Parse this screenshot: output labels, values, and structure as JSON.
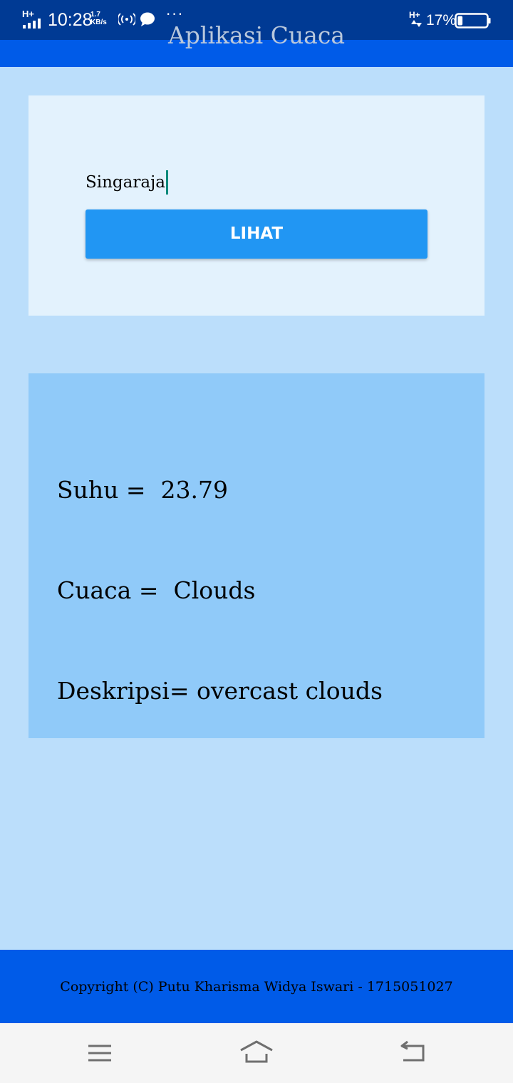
{
  "status_bar": {
    "network_type": "H+",
    "time": "10:28",
    "speed_value": "1.7",
    "speed_unit": "KB/s",
    "more_indicator": "···",
    "network_type_right": "H+",
    "battery_percent": "17%",
    "battery_level": 0.17,
    "icons": [
      "signal-icon",
      "hotspot-icon",
      "chat-bubble-icon",
      "network-arrows-icon",
      "battery-icon"
    ]
  },
  "app_bar": {
    "title": "Aplikasi Cuaca"
  },
  "search": {
    "city_value": "Singaraja",
    "button_label": "LIHAT"
  },
  "result": {
    "suhu_label": "Suhu = ",
    "suhu_value": " 23.79",
    "cuaca_label": "Cuaca = ",
    "cuaca_value": " Clouds",
    "deskripsi_label": "Deskripsi=",
    "deskripsi_value": " overcast clouds"
  },
  "footer": {
    "copyright": "Copyright (C) Putu Kharisma Widya Iswari - 1715051027"
  },
  "navigation": {
    "icons": [
      "menu-icon",
      "home-icon",
      "back-icon"
    ]
  },
  "colors": {
    "status_bar": "#003a94",
    "app_bar": "#005be8",
    "page_background": "#bbdefb",
    "input_card": "#e3f2fd",
    "button": "#2196f3",
    "result_card": "#90caf9",
    "cursor": "#00897b"
  }
}
